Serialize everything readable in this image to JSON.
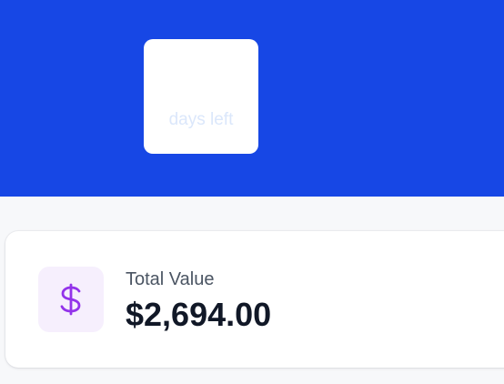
{
  "hero": {
    "background_color": "#1747e5",
    "days_caption": "days left"
  },
  "value_card": {
    "icon": "dollar-sign-icon",
    "icon_color": "#9333ea",
    "label": "Total Value",
    "value": "$2,694.00"
  }
}
